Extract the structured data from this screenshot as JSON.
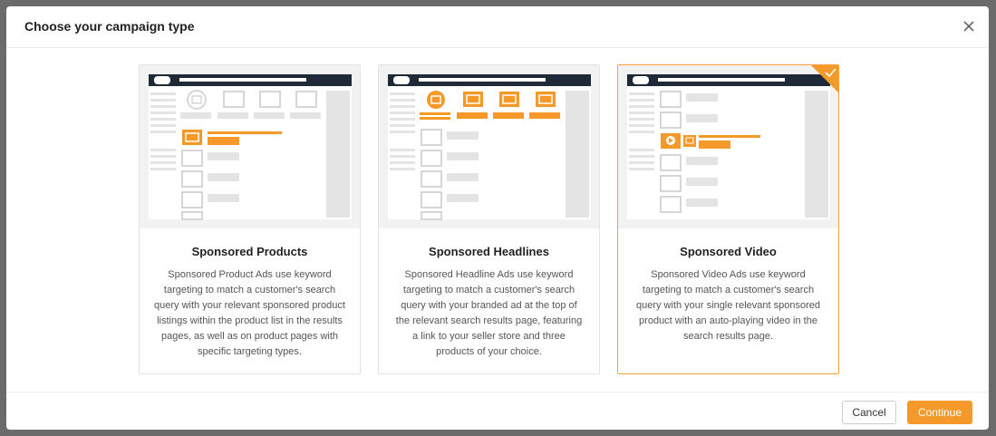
{
  "modal": {
    "title": "Choose your campaign type",
    "close_icon": "close-icon"
  },
  "cards": [
    {
      "title": "Sponsored Products",
      "description": "Sponsored Product Ads use keyword targeting to match a customer's search query with your relevant sponsored product listings within the product list in the results pages, as well as on product pages with specific targeting types.",
      "selected": false
    },
    {
      "title": "Sponsored Headlines",
      "description": "Sponsored Headline Ads use keyword targeting to match a customer's search query with your branded ad at the top of the relevant search results page, featuring a link to your seller store and three products of your choice.",
      "selected": false
    },
    {
      "title": "Sponsored Video",
      "description": "Sponsored Video Ads use keyword targeting to match a customer's search query with your single relevant sponsored product with an auto-playing video in the search results page.",
      "selected": true
    }
  ],
  "footer": {
    "cancel_label": "Cancel",
    "continue_label": "Continue"
  },
  "colors": {
    "accent": "#f59a2a",
    "preview_header": "#1e2a38",
    "placeholder": "#d6d6d6"
  }
}
